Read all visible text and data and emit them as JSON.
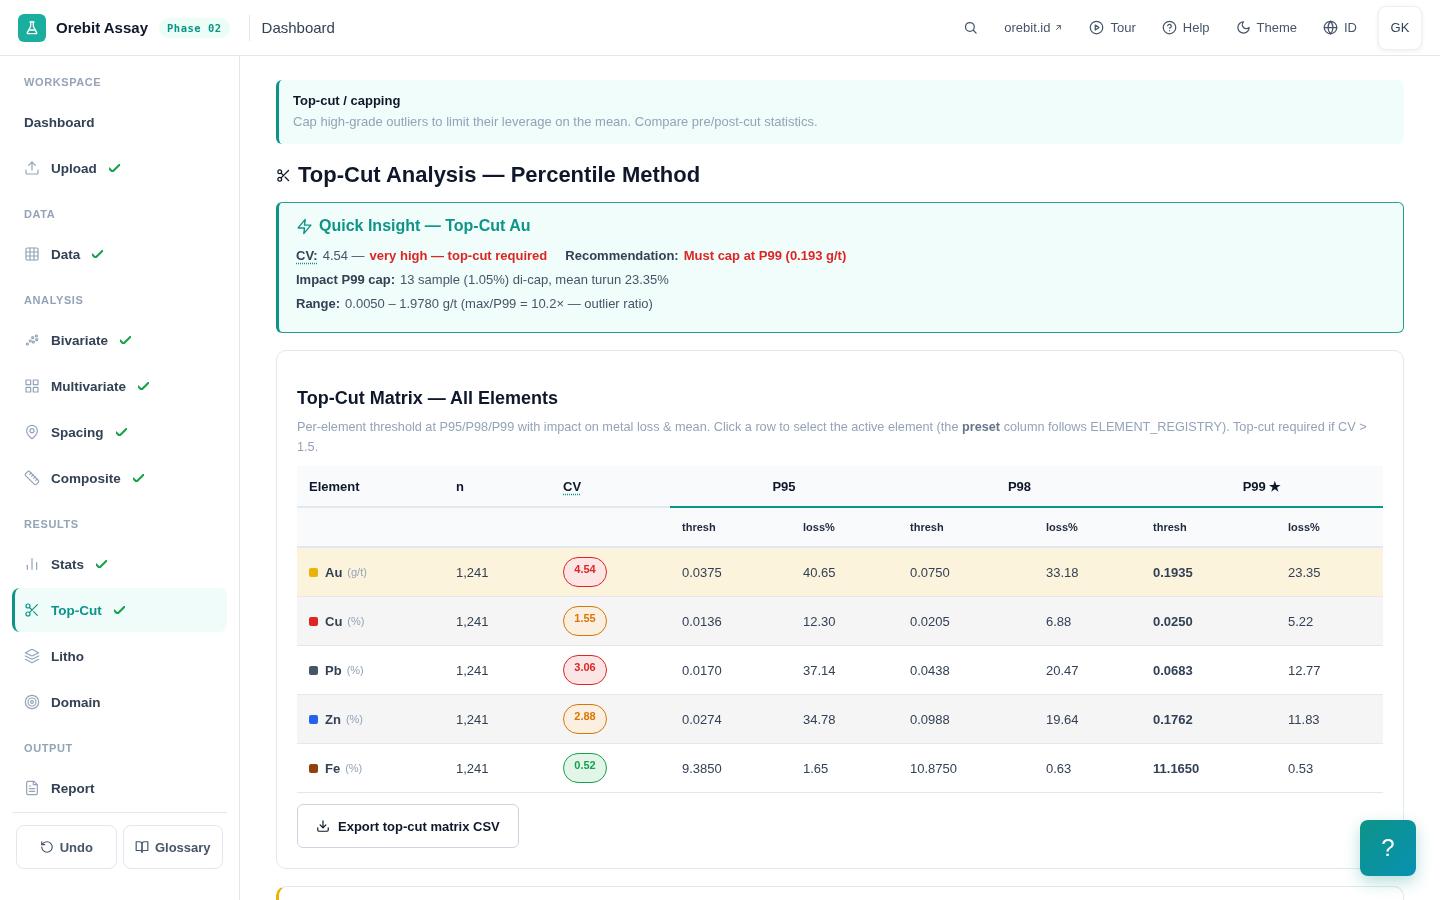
{
  "topbar": {
    "brand": "Orebit Assay",
    "phase_badge": "Phase 02",
    "page_title": "Dashboard",
    "actions": [
      {
        "kind": "search"
      },
      {
        "kind": "external",
        "label": "orebit.id"
      },
      {
        "kind": "tour",
        "label": "Tour"
      },
      {
        "kind": "help",
        "label": "Help"
      },
      {
        "kind": "theme",
        "label": "Theme"
      },
      {
        "kind": "language",
        "label": "ID"
      }
    ],
    "avatar": "GK"
  },
  "sidebar": {
    "sections": [
      {
        "heading": "WORKSPACE",
        "items": [
          {
            "label": "Dashboard",
            "kind": "text",
            "done": false,
            "selected": false
          },
          {
            "label": "Upload",
            "kind": "upload",
            "done": true,
            "selected": false
          }
        ]
      },
      {
        "heading": "DATA",
        "items": [
          {
            "label": "Data",
            "kind": "table",
            "done": true,
            "selected": false
          }
        ]
      },
      {
        "heading": "ANALYSIS",
        "items": [
          {
            "label": "Bivariate",
            "kind": "scatter",
            "done": true,
            "selected": false
          },
          {
            "label": "Multivariate",
            "kind": "tiles",
            "done": true,
            "selected": false
          },
          {
            "label": "Spacing",
            "kind": "pin",
            "done": true,
            "selected": false
          },
          {
            "label": "Composite",
            "kind": "ruler",
            "done": true,
            "selected": false
          }
        ]
      },
      {
        "heading": "RESULTS",
        "items": [
          {
            "label": "Stats",
            "kind": "bars",
            "done": true,
            "selected": false
          },
          {
            "label": "Top-Cut",
            "kind": "scissors",
            "done": true,
            "selected": true
          },
          {
            "label": "Litho",
            "kind": "layers",
            "done": false,
            "selected": false
          },
          {
            "label": "Domain",
            "kind": "target",
            "done": false,
            "selected": false
          }
        ]
      },
      {
        "heading": "OUTPUT",
        "items": [
          {
            "label": "Report",
            "kind": "document",
            "done": false,
            "selected": false
          }
        ]
      }
    ],
    "footer_buttons": [
      {
        "kind": "undo",
        "label": "Undo"
      },
      {
        "kind": "glossary",
        "label": "Glossary"
      }
    ]
  },
  "callout": {
    "title": "Top-cut / capping",
    "text": "Cap high-grade outliers to limit their leverage on the mean. Compare pre/post-cut statistics."
  },
  "heading": "Top-Cut Analysis — Percentile Method",
  "insight": {
    "title": "Quick Insight — Top-Cut Au",
    "lines": [
      [
        {
          "kind": "term",
          "text": "CV:"
        },
        {
          "kind": "plain",
          "text": "4.54 —"
        },
        {
          "kind": "alert",
          "text": "very high — top-cut required"
        },
        {
          "kind": "label",
          "text": "Recommendation:"
        },
        {
          "kind": "alert",
          "text": "Must cap at P99 (0.193 g/t)"
        }
      ],
      [
        {
          "kind": "label",
          "text": "Impact P99 cap:"
        },
        {
          "kind": "plain",
          "text": "13 sample (1.05%) di-cap, mean turun 23.35%"
        }
      ],
      [
        {
          "kind": "label",
          "text": "Range:"
        },
        {
          "kind": "plain",
          "text": "0.0050 – 1.9780 g/t (max/P99 = 10.2× — outlier ratio)"
        }
      ]
    ]
  },
  "matrix": {
    "title": "Top-Cut Matrix — All Elements",
    "description": "Per-element threshold at P95/P98/P99 with impact on metal loss & mean. Click a row to select the active element (the **preset** column follows ELEMENT_REGISTRY). Top-cut required if CV > 1.5.",
    "columns": [
      {
        "label": "Element",
        "kind": "plain"
      },
      {
        "label": "n",
        "kind": "plain"
      },
      {
        "label": "CV",
        "kind": "term"
      }
    ],
    "groups": [
      {
        "label": "P95",
        "columns": [
          "thresh",
          "loss%"
        ]
      },
      {
        "label": "P98",
        "columns": [
          "thresh",
          "loss%"
        ]
      },
      {
        "label": "P99 ★",
        "columns": [
          "thresh",
          "loss%"
        ]
      }
    ],
    "rows": [
      {
        "element": "Au",
        "unit": "(g/t)",
        "color": "#eab308",
        "n": "1,241",
        "cv": {
          "value": "4.54",
          "color": "#dc2626"
        },
        "values": [
          "0.0375",
          "40.65",
          "0.0750",
          "33.18",
          "0.1935",
          "23.35"
        ],
        "selected": true
      },
      {
        "element": "Cu",
        "unit": "(%)",
        "color": "#dc2626",
        "n": "1,241",
        "cv": {
          "value": "1.55",
          "color": "#d97706"
        },
        "values": [
          "0.0136",
          "12.30",
          "0.0205",
          "6.88",
          "0.0250",
          "5.22"
        ],
        "selected": false
      },
      {
        "element": "Pb",
        "unit": "(%)",
        "color": "#475569",
        "n": "1,241",
        "cv": {
          "value": "3.06",
          "color": "#dc2626"
        },
        "values": [
          "0.0170",
          "37.14",
          "0.0438",
          "20.47",
          "0.0683",
          "12.77"
        ],
        "selected": false
      },
      {
        "element": "Zn",
        "unit": "(%)",
        "color": "#2563eb",
        "n": "1,241",
        "cv": {
          "value": "2.88",
          "color": "#d97706"
        },
        "values": [
          "0.0274",
          "34.78",
          "0.0988",
          "19.64",
          "0.1762",
          "11.83"
        ],
        "selected": false
      },
      {
        "element": "Fe",
        "unit": "(%)",
        "color": "#92400e",
        "n": "1,241",
        "cv": {
          "value": "0.52",
          "color": "#16a34a"
        },
        "values": [
          "9.3850",
          "1.65",
          "10.8750",
          "0.63",
          "11.1650",
          "0.53"
        ],
        "selected": false
      }
    ],
    "export_button": "Export top-cut matrix CSV"
  },
  "help_button": "?"
}
